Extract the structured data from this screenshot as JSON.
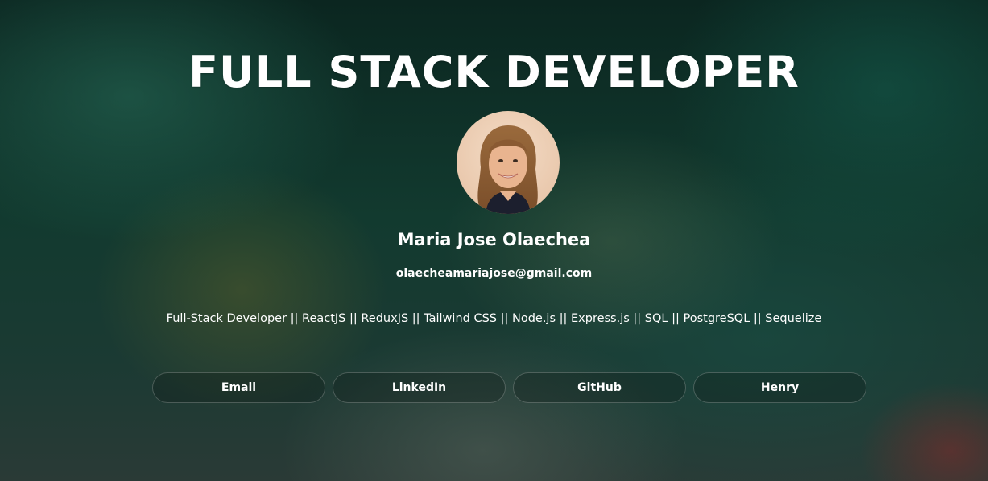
{
  "header": {
    "title": "FULL STACK DEVELOPER"
  },
  "profile": {
    "name": "Maria Jose Olaechea",
    "email": "olaecheamariajose@gmail.com",
    "headline": "Full-Stack Developer || ReactJS || ReduxJS || Tailwind CSS || Node.js || Express.js || SQL || PostgreSQL || Sequelize",
    "avatar_icon": "profile-photo"
  },
  "links": [
    {
      "label": "Email"
    },
    {
      "label": "LinkedIn"
    },
    {
      "label": "GitHub"
    },
    {
      "label": "Henry"
    }
  ],
  "colors": {
    "background": "#0d2a22",
    "text": "#ffffff",
    "button_border": "#5a6a66"
  }
}
